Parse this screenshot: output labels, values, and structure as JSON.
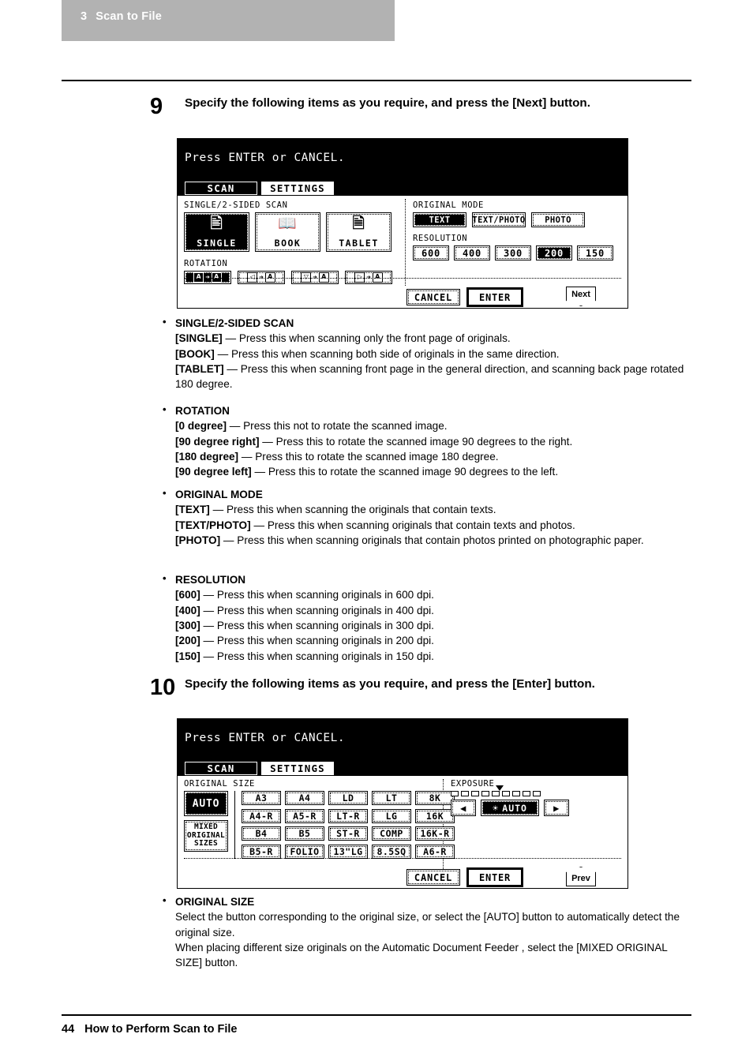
{
  "chapter": {
    "number": "3",
    "title": "Scan to File"
  },
  "footer": {
    "page": "44",
    "title": "How to Perform Scan to File"
  },
  "steps": [
    {
      "number": "9",
      "text": "Specify the following items as you require, and press the [Next] button."
    },
    {
      "number": "10",
      "text": "Specify the following items as you require, and press the [Enter] button."
    }
  ],
  "panel1": {
    "title": "Press ENTER or CANCEL.",
    "tabs": [
      {
        "label": "SCAN",
        "selected": true
      },
      {
        "label": "SETTINGS",
        "selected": false
      }
    ],
    "sided_scan": {
      "label": "SINGLE/2-SIDED SCAN",
      "buttons": [
        {
          "label": "SINGLE",
          "icon": "single-page-icon",
          "selected": true
        },
        {
          "label": "BOOK",
          "icon": "open-book-icon",
          "selected": false
        },
        {
          "label": "TABLET",
          "icon": "tablet-pages-icon",
          "selected": false
        }
      ]
    },
    "rotation": {
      "label": "ROTATION",
      "buttons": [
        {
          "from": "A",
          "to": "A",
          "name": "rotation-0-degree",
          "selected": true
        },
        {
          "from": "◁",
          "to": "A",
          "name": "rotation-90-right",
          "selected": false
        },
        {
          "from": "▽",
          "to": "A",
          "name": "rotation-180",
          "selected": false
        },
        {
          "from": "▷",
          "to": "A",
          "name": "rotation-90-left",
          "selected": false
        }
      ]
    },
    "original_mode": {
      "label": "ORIGINAL MODE",
      "buttons": [
        {
          "label": "TEXT",
          "selected": true
        },
        {
          "label": "TEXT/PHOTO",
          "selected": false
        },
        {
          "label": "PHOTO",
          "selected": false
        }
      ]
    },
    "resolution": {
      "label": "RESOLUTION",
      "buttons": [
        {
          "label": "600",
          "selected": false
        },
        {
          "label": "400",
          "selected": false
        },
        {
          "label": "300",
          "selected": false
        },
        {
          "label": "200",
          "selected": true
        },
        {
          "label": "150",
          "selected": false
        }
      ]
    },
    "actions": {
      "cancel": "CANCEL",
      "enter": "ENTER",
      "nav": "Next"
    }
  },
  "panel2": {
    "title": "Press ENTER or CANCEL.",
    "tabs": [
      {
        "label": "SCAN",
        "selected": true
      },
      {
        "label": "SETTINGS",
        "selected": false
      }
    ],
    "original_size": {
      "label": "ORIGINAL SIZE",
      "auto": {
        "label": "AUTO",
        "selected": true
      },
      "mixed": {
        "line1": "MIXED",
        "line2": "ORIGINAL",
        "line3": "SIZES",
        "selected": false
      },
      "sizes": [
        "A3",
        "A4",
        "LD",
        "LT",
        "8K",
        "A4-R",
        "A5-R",
        "LT-R",
        "LG",
        "16K",
        "B4",
        "B5",
        "ST-R",
        "COMP",
        "16K-R",
        "B5-R",
        "FOLIO",
        "13\"LG",
        "8.5SQ",
        "A6-R"
      ]
    },
    "exposure": {
      "label": "EXPOSURE",
      "segments": 9,
      "marker_index": 5,
      "left_arrow": "◀",
      "right_arrow": "▶",
      "auto_label": "AUTO",
      "auto_selected": true
    },
    "actions": {
      "cancel": "CANCEL",
      "enter": "ENTER",
      "nav": "Prev"
    }
  },
  "bullets": [
    {
      "head": "SINGLE/2-SIDED SCAN",
      "lines": [
        {
          "term": "[SINGLE]",
          "desc": " — Press this when scanning only the front page of originals."
        },
        {
          "term": "[BOOK]",
          "desc": " — Press this when scanning both side of originals in the same direction."
        },
        {
          "term": "[TABLET]",
          "desc": " — Press this when scanning front page in the general direction, and scanning back page rotated 180 degree."
        }
      ]
    },
    {
      "head": "ROTATION",
      "lines": [
        {
          "term": "[0 degree]",
          "desc": " — Press this not to rotate the scanned image."
        },
        {
          "term": "[90 degree right]",
          "desc": " — Press this to rotate the scanned image 90 degrees to the right."
        },
        {
          "term": "[180 degree]",
          "desc": " — Press this to rotate the scanned image 180 degree."
        },
        {
          "term": "[90 degree left]",
          "desc": " — Press this to rotate the scanned image 90 degrees to the left."
        }
      ]
    },
    {
      "head": "ORIGINAL MODE",
      "lines": [
        {
          "term": "[TEXT]",
          "desc": " — Press this when scanning the originals that contain texts."
        },
        {
          "term": "[TEXT/PHOTO]",
          "desc": " — Press this when scanning originals that contain texts and photos."
        },
        {
          "term": "[PHOTO]",
          "desc": " — Press this when scanning originals that contain photos printed on photographic paper."
        }
      ]
    },
    {
      "head": "RESOLUTION",
      "lines": [
        {
          "term": "[600]",
          "desc": " — Press this when scanning originals in 600 dpi."
        },
        {
          "term": "[400]",
          "desc": " — Press this when scanning originals in 400 dpi."
        },
        {
          "term": "[300]",
          "desc": " — Press this when scanning originals in 300 dpi."
        },
        {
          "term": "[200]",
          "desc": " — Press this when scanning originals in 200 dpi."
        },
        {
          "term": "[150]",
          "desc": " — Press this when scanning originals in 150 dpi."
        }
      ]
    },
    {
      "head": "ORIGINAL SIZE",
      "lines": [
        {
          "term": "",
          "desc": "Select the button corresponding to the original size, or select the [AUTO] button to automatically detect the original size."
        },
        {
          "term": "",
          "desc": "When placing different size originals on the Automatic Document Feeder , select the [MIXED ORIGINAL SIZE] button."
        }
      ]
    }
  ]
}
